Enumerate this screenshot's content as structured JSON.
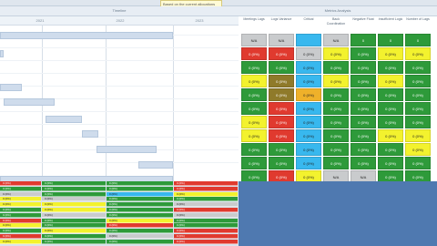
{
  "header": {
    "tooltip_text": "Based on the current allocations"
  },
  "timeline": {
    "title": "Timeline",
    "years": [
      "2021",
      "2022",
      "2023"
    ]
  },
  "metrics": {
    "title": "Metrics Analysis",
    "columns": [
      "Meetings Lags",
      "Logs Variance",
      "Critical",
      "Back Coordination",
      "Negative Float",
      "Insufficient Logic",
      "Number of Lags"
    ],
    "rows": [
      [
        "N/A",
        "N/A",
        "",
        "N/A",
        "0",
        "0",
        "0"
      ],
      [
        "0 (0%)",
        "0 (0%)",
        "0 (0%)",
        "0 (0%)",
        "0 (0%)",
        "0 (0%)",
        "0 (0%)"
      ],
      [
        "0 (0%)",
        "0 (0%)",
        "0 (0%)",
        "0 (0%)",
        "0 (0%)",
        "0 (0%)",
        "0 (0%)"
      ],
      [
        "0 (0%)",
        "0 (0%)",
        "0 (0%)",
        "0 (0%)",
        "0 (0%)",
        "0 (0%)",
        "0 (0%)"
      ],
      [
        "0 (0%)",
        "0 (0%)",
        "0 (0%)",
        "0 (0%)",
        "0 (0%)",
        "0 (0%)",
        "0 (0%)"
      ],
      [
        "0 (0%)",
        "0 (0%)",
        "0 (0%)",
        "0 (0%)",
        "0 (0%)",
        "0 (0%)",
        "0 (0%)"
      ],
      [
        "0 (0%)",
        "0 (0%)",
        "0 (0%)",
        "0 (0%)",
        "0 (0%)",
        "0 (0%)",
        "0 (0%)"
      ],
      [
        "0 (0%)",
        "0 (0%)",
        "0 (0%)",
        "0 (0%)",
        "0 (0%)",
        "0 (0%)",
        "0 (0%)"
      ],
      [
        "0 (0%)",
        "0 (0%)",
        "0 (0%)",
        "0 (0%)",
        "0 (0%)",
        "0 (0%)",
        "0 (0%)"
      ],
      [
        "0 (0%)",
        "0 (0%)",
        "0 (0%)",
        "0 (0%)",
        "0 (0%)",
        "0 (0%)",
        "0 (0%)"
      ],
      [
        "0 (0%)",
        "0 (0%)",
        "0 (0%)",
        "N/A",
        "N/A",
        "0 (0%)",
        "0 (0%)"
      ]
    ]
  },
  "summary": {
    "rows": [
      [
        "0 (0%)",
        "0 (0%)",
        "0 (0%)",
        "0 (0%)"
      ],
      [
        "0 (0%)",
        "0 (0%)",
        "0 (0%)",
        "0 (0%)"
      ],
      [
        "0 (0%)",
        "0 (0%)",
        "0 (0%)",
        "0 (0%)"
      ],
      [
        "0 (0%)",
        "0 (0%)",
        "0 (0%)",
        "0 (0%)"
      ],
      [
        "0 (0%)",
        "0 (0%)",
        "0 (0%)",
        "0 (0%)"
      ],
      [
        "0 (0%)",
        "0 (0%)",
        "0 (0%)",
        "0 (0%)"
      ],
      [
        "0 (0%)",
        "0 (0%)",
        "0 (0%)",
        "0 (0%)"
      ],
      [
        "0 (0%)",
        "0 (0%)",
        "0 (0%)",
        "0 (0%)"
      ],
      [
        "0 (0%)",
        "0 (0%)",
        "0 (0%)",
        "0 (0%)"
      ],
      [
        "0 (0%)",
        "0 (0%)",
        "0 (0%)",
        "0 (0%)"
      ],
      [
        "0 (0%)",
        "0 (0%)",
        "0 (0%)",
        "0 (0%)"
      ],
      [
        "0 (0%)",
        "0 (0%)",
        "0 (0%)",
        "0 (0%)"
      ]
    ]
  },
  "colors": {
    "green": "#2e9a3a",
    "red": "#e03a2f",
    "yellow": "#f3f22e",
    "gray": "#c9cbcd",
    "olive": "#8f7a2a",
    "orange": "#efb12a",
    "cyan": "#38b8ee",
    "accent_blue": "#4f79b0"
  }
}
